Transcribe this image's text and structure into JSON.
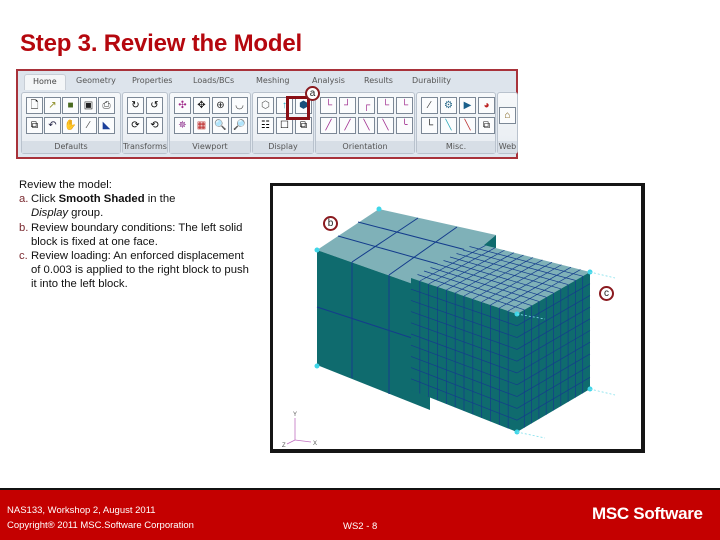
{
  "slide": {
    "title": "Step 3. Review the Model"
  },
  "ribbon": {
    "tabs": [
      "Home",
      "Geometry",
      "Properties",
      "Loads/BCs",
      "Meshing",
      "Analysis",
      "Results",
      "Durability"
    ],
    "active_tab": "Home",
    "groups": [
      {
        "label": "Defaults",
        "icons": [
          "new-file-icon",
          "open-file-icon",
          "open-db-icon",
          "save-icon",
          "print-icon",
          "copy-icon",
          "undo-icon",
          "select-hand-icon",
          "pick-icon",
          "highlight-icon"
        ]
      },
      {
        "label": "Transforms",
        "icons": [
          "rotate-x-icon",
          "rotate-y-icon",
          "rotate-z-icon",
          "rotate-free-icon"
        ]
      },
      {
        "label": "Viewport",
        "icons": [
          "fit-view-icon",
          "pan-icon",
          "translate-icon",
          "rotate-view-icon",
          "zoom-view-icon",
          "viewport-grid-icon",
          "zoom-in-icon",
          "zoom-out-icon"
        ]
      },
      {
        "label": "Display",
        "icons": [
          "wireframe-icon",
          "hidden-line-icon",
          "smooth-shaded-icon",
          "tile-icon",
          "layer-icon",
          "group-icon"
        ]
      },
      {
        "label": "Orientation",
        "icons": [
          "front-view-icon",
          "back-view-icon",
          "left-view-icon",
          "right-view-icon",
          "top-view-icon",
          "bottom-view-icon",
          "iso1-view-icon",
          "iso2-view-icon",
          "iso3-view-icon",
          "iso4-view-icon"
        ]
      },
      {
        "label": "Misc.",
        "icons": [
          "measure-icon",
          "render-icon",
          "shade-icon",
          "color-icon",
          "triad-icon",
          "point-icon",
          "node-icon",
          "label-icon"
        ]
      },
      {
        "label": "Web",
        "icons": [
          "web-home-icon"
        ]
      }
    ],
    "highlighted_button": "Smooth Shaded",
    "callout_a": "a"
  },
  "instructions": {
    "intro": "Review the model:",
    "items": [
      {
        "marker": "a.",
        "pre": "Click ",
        "bold": "Smooth Shaded",
        "mid": " in the ",
        "italic": "Display",
        "post": " group."
      },
      {
        "marker": "b.",
        "text": "Review boundary conditions: The left solid block is fixed at one face."
      },
      {
        "marker": "c.",
        "text": "Review loading: An enforced displacement of 0.003 is applied to the right block to push it into the left block."
      }
    ]
  },
  "model_view": {
    "callout_b": "b",
    "callout_c": "c",
    "triad": {
      "x": "X",
      "y": "Y",
      "z": "Z"
    },
    "colors": {
      "side_face": "#0f6b6e",
      "top_face": "#7fb1b8",
      "mesh_line": "#143c8c",
      "bc_marker": "#3fd6e8"
    }
  },
  "footer": {
    "line1": "NAS133, Workshop 2, August 2011",
    "line2": "Copyright® 2011 MSC.Software Corporation",
    "page": "WS2 - 8",
    "logo": "MSC Software"
  }
}
